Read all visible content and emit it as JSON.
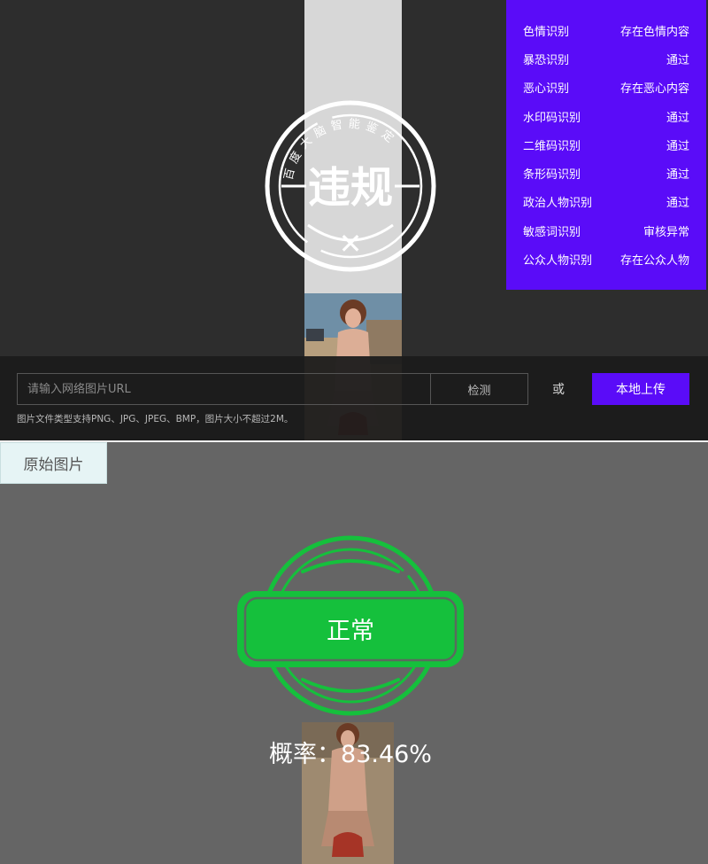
{
  "results": [
    {
      "label": "色情识别",
      "value": "存在色情内容"
    },
    {
      "label": "暴恐识别",
      "value": "通过"
    },
    {
      "label": "恶心识别",
      "value": "存在恶心内容"
    },
    {
      "label": "水印码识别",
      "value": "通过"
    },
    {
      "label": "二维码识别",
      "value": "通过"
    },
    {
      "label": "条形码识别",
      "value": "通过"
    },
    {
      "label": "政治人物识别",
      "value": "通过"
    },
    {
      "label": "敏感词识别",
      "value": "审核异常"
    },
    {
      "label": "公众人物识别",
      "value": "存在公众人物"
    }
  ],
  "stamp": {
    "ring_text": "百度大脑智能鉴定",
    "verdict": "违规",
    "mark": "✕"
  },
  "upload": {
    "placeholder": "请输入网络图片URL",
    "detect_label": "检测",
    "or_label": "或",
    "upload_label": "本地上传",
    "hint": "图片文件类型支持PNG、JPG、JPEG、BMP，图片大小不超过2M。"
  },
  "bottom": {
    "tab_label": "原始图片",
    "verdict": "正常",
    "probability": "概率：83.46%"
  },
  "colors": {
    "accent": "#5a0cf8",
    "ok_green": "#15c03c",
    "stamp_white": "#ffffff"
  }
}
